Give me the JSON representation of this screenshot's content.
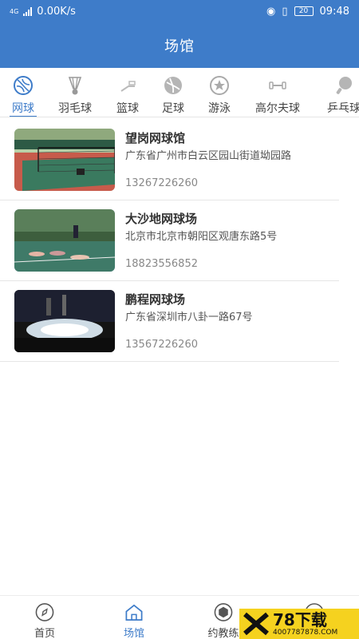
{
  "status_bar": {
    "network_type": "4G",
    "speed": "0.00K/s",
    "battery": "20",
    "time": "09:48"
  },
  "header": {
    "title": "场馆"
  },
  "category_tabs": [
    {
      "label": "网球",
      "icon": "tennis-icon",
      "active": true
    },
    {
      "label": "羽毛球",
      "icon": "badminton-icon",
      "active": false
    },
    {
      "label": "篮球",
      "icon": "basketball-icon",
      "active": false
    },
    {
      "label": "足球",
      "icon": "football-icon",
      "active": false
    },
    {
      "label": "游泳",
      "icon": "swimming-icon",
      "active": false
    },
    {
      "label": "高尔夫球",
      "icon": "golf-icon",
      "active": false
    },
    {
      "label": "乒乓球",
      "icon": "table-tennis-icon",
      "active": false
    }
  ],
  "venues": [
    {
      "name": "望岗网球馆",
      "address": "广东省广州市白云区园山街道坳园路",
      "phone": "13267226260"
    },
    {
      "name": "大沙地网球场",
      "address": "北京市北京市朝阳区观唐东路5号",
      "phone": "18823556852"
    },
    {
      "name": "鹏程网球场",
      "address": "广东省深圳市八卦一路67号",
      "phone": "13567226260"
    }
  ],
  "bottom_nav": [
    {
      "label": "首页",
      "icon": "compass-icon",
      "active": false
    },
    {
      "label": "场馆",
      "icon": "home-icon",
      "active": true
    },
    {
      "label": "约教练",
      "icon": "hexagon-icon",
      "active": false
    },
    {
      "label": "",
      "icon": "profile-icon",
      "active": false
    }
  ],
  "watermark": {
    "big": "78下载",
    "small": "4007787878.COM"
  },
  "colors": {
    "primary": "#3e7cc9",
    "divider": "#e6e6e6",
    "watermark": "#f5d21f"
  }
}
